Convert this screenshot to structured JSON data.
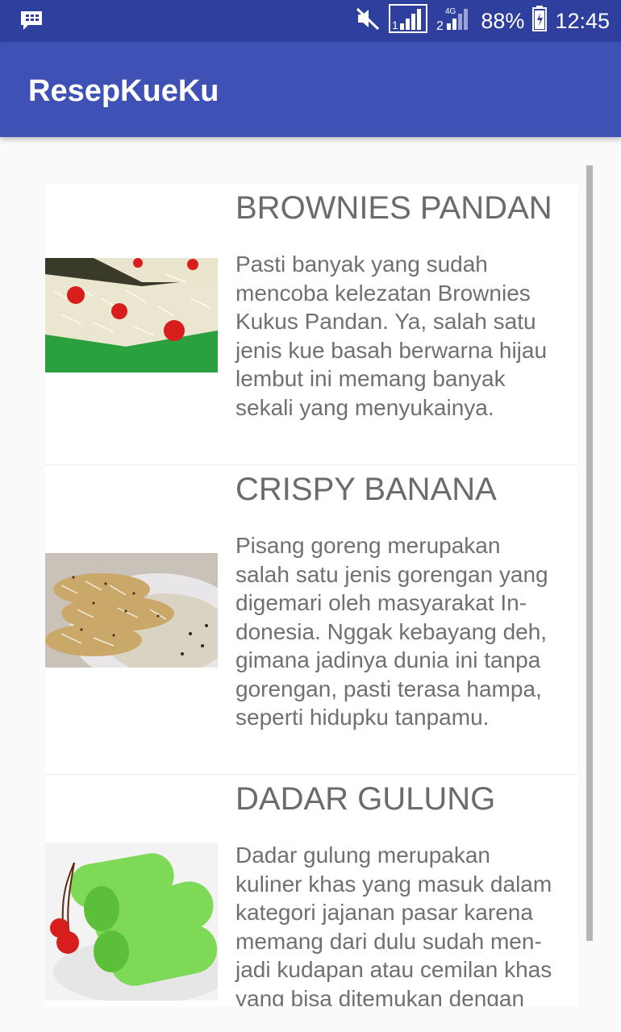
{
  "status_bar": {
    "battery": "88%",
    "time": "12:45",
    "network_label": "4G"
  },
  "app_bar": {
    "title": "ResepKueKu"
  },
  "recipes": [
    {
      "title": "BROWNIES PANDAN",
      "description_lines": [
        "Pasti banyak yang sudah",
        "mencoba kelezatan Brownies",
        "Kukus Pandan. Ya, salah satu",
        "jenis kue basah berwarna hijau",
        "lembut ini memang banyak",
        "sekali yang menyukainya."
      ],
      "image": "brownies-pandan-photo"
    },
    {
      "title": "CRISPY BANANA",
      "description_lines": [
        "Pisang goreng merupakan",
        "salah satu jenis gorengan yang",
        "digemari oleh masyarakat In-",
        "donesia. Nggak kebayang deh,",
        "gimana jadinya dunia ini tanpa",
        "gorengan, pasti terasa hampa,",
        "seperti hidupku tanpamu."
      ],
      "image": "crispy-banana-photo"
    },
    {
      "title": "DADAR GULUNG",
      "description_lines": [
        "Dadar gulung merupakan",
        "kuliner khas yang masuk dalam",
        "kategori jajanan pasar karena",
        "memang dari dulu sudah men-",
        "jadi kudapan atau cemilan khas",
        "yang bisa ditemukan dengan"
      ],
      "image": "dadar-gulung-photo"
    }
  ],
  "colors": {
    "status_bar": "#2f3f9e",
    "app_bar": "#3f51b5",
    "background": "#fafafa"
  }
}
